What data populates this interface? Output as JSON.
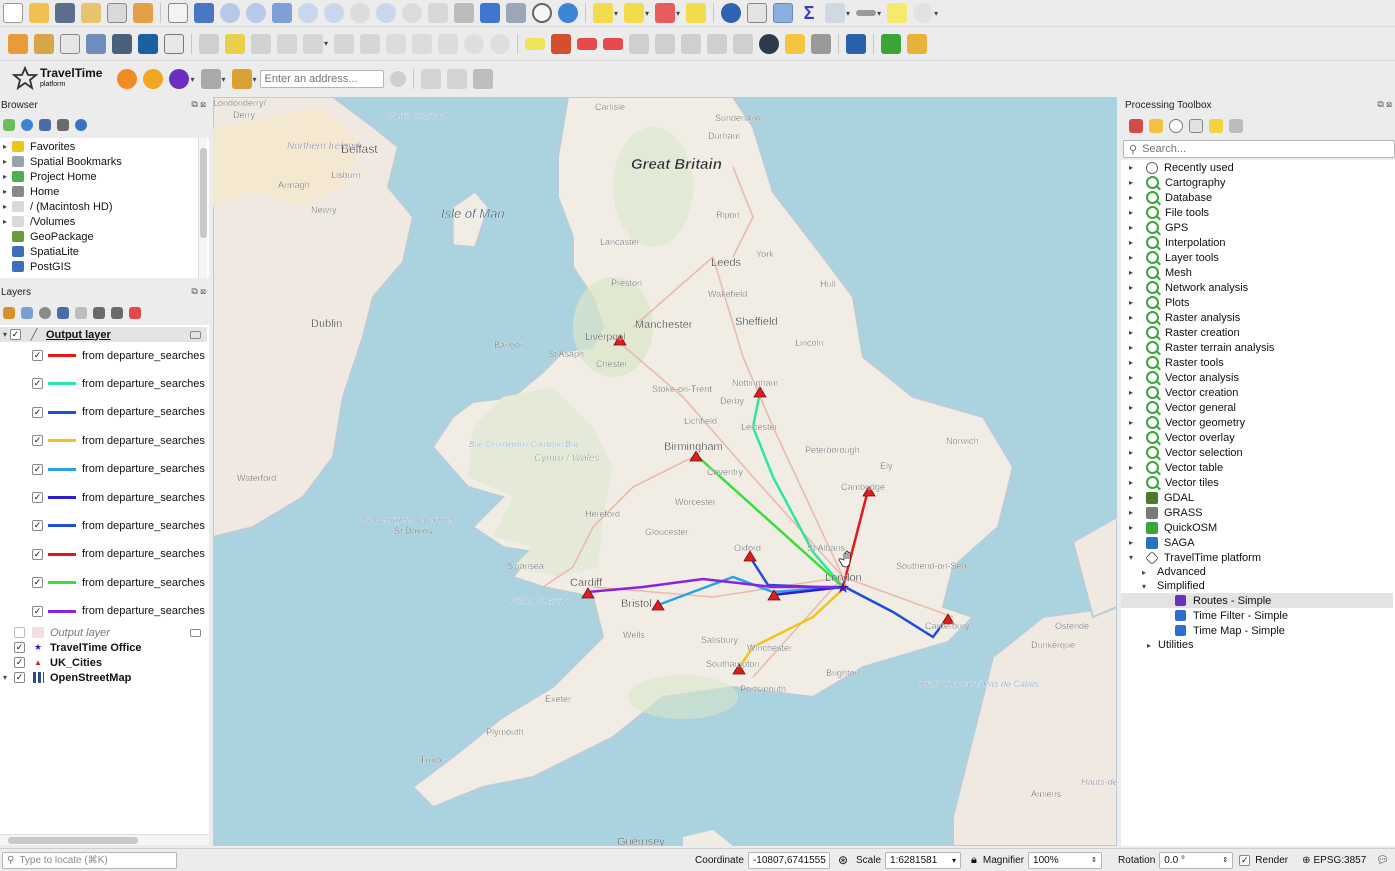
{
  "address": {
    "placeholder": "Enter an address..."
  },
  "plugin": {
    "name": "TravelTime",
    "sub": "platform"
  },
  "browser": {
    "title": "Browser",
    "items": [
      {
        "label": "Favorites"
      },
      {
        "label": "Spatial Bookmarks"
      },
      {
        "label": "Project Home"
      },
      {
        "label": "Home"
      },
      {
        "label": "/ (Macintosh HD)"
      },
      {
        "label": "/Volumes"
      },
      {
        "label": "GeoPackage"
      },
      {
        "label": "SpatiaLite"
      },
      {
        "label": "PostGIS"
      }
    ]
  },
  "layers": {
    "title": "Layers",
    "group1": "Output layer",
    "routes": [
      {
        "label": "from departure_searches",
        "color": "#e8151b"
      },
      {
        "label": "from departure_searches",
        "color": "#2fe6a0"
      },
      {
        "label": "from departure_searches",
        "color": "#1a4fd6"
      },
      {
        "label": "from departure_searches",
        "color": "#f5c21b"
      },
      {
        "label": "from departure_searches",
        "color": "#27a3e8"
      },
      {
        "label": "from departure_searches",
        "color": "#2c1fcf"
      },
      {
        "label": "from departure_searches",
        "color": "#1d4fd8"
      },
      {
        "label": "from departure_searches",
        "color": "#e4161b"
      },
      {
        "label": "from departure_searches",
        "color": "#37e037"
      },
      {
        "label": "from departure_searches",
        "color": "#8a22e0"
      }
    ],
    "group2": "Output layer",
    "office": "TravelTime Office",
    "cities": "UK_Cities",
    "osm": "OpenStreetMap"
  },
  "toolbox": {
    "title": "Processing Toolbox",
    "search_placeholder": "Search...",
    "recent": "Recently used",
    "groups": [
      {
        "label": "Cartography"
      },
      {
        "label": "Database"
      },
      {
        "label": "File tools"
      },
      {
        "label": "GPS"
      },
      {
        "label": "Interpolation"
      },
      {
        "label": "Layer tools"
      },
      {
        "label": "Mesh"
      },
      {
        "label": "Network analysis"
      },
      {
        "label": "Plots"
      },
      {
        "label": "Raster analysis"
      },
      {
        "label": "Raster creation"
      },
      {
        "label": "Raster terrain analysis"
      },
      {
        "label": "Raster tools"
      },
      {
        "label": "Vector analysis"
      },
      {
        "label": "Vector creation"
      },
      {
        "label": "Vector general"
      },
      {
        "label": "Vector geometry"
      },
      {
        "label": "Vector overlay"
      },
      {
        "label": "Vector selection"
      },
      {
        "label": "Vector table"
      },
      {
        "label": "Vector tiles"
      }
    ],
    "providers": [
      {
        "label": "GDAL"
      },
      {
        "label": "GRASS"
      },
      {
        "label": "QuickOSM"
      },
      {
        "label": "SAGA"
      }
    ],
    "tt": "TravelTime platform",
    "advanced": "Advanced",
    "simplified": "Simplified",
    "tools": [
      {
        "label": "Routes - Simple"
      },
      {
        "label": "Time Filter - Simple"
      },
      {
        "label": "Time Map - Simple"
      }
    ],
    "utilities": "Utilities"
  },
  "status": {
    "locate_placeholder": "Type to locate (⌘K)",
    "coord_label": "Coordinate",
    "coord": "-10807,6741555",
    "scale_label": "Scale",
    "scale": "1:6281581",
    "mag_label": "Magnifier",
    "mag": "100%",
    "rot_label": "Rotation",
    "rot": "0.0 °",
    "render": "Render",
    "crs": "EPSG:3857"
  },
  "map": {
    "places": [
      {
        "name": "Great Britain"
      },
      {
        "name": "Isle of Man"
      },
      {
        "name": "Belfast"
      },
      {
        "name": "Dublin"
      },
      {
        "name": "Liverpool"
      },
      {
        "name": "Manchester"
      },
      {
        "name": "Sheffield"
      },
      {
        "name": "Leeds"
      },
      {
        "name": "York"
      },
      {
        "name": "Hull"
      },
      {
        "name": "Lincoln"
      },
      {
        "name": "Nottingham"
      },
      {
        "name": "Derby"
      },
      {
        "name": "Leicester"
      },
      {
        "name": "Birmingham"
      },
      {
        "name": "Coventry"
      },
      {
        "name": "Peterborough"
      },
      {
        "name": "Norwich"
      },
      {
        "name": "Cambridge"
      },
      {
        "name": "Ely"
      },
      {
        "name": "Oxford"
      },
      {
        "name": "St Albans"
      },
      {
        "name": "London"
      },
      {
        "name": "Southend-on-Sea"
      },
      {
        "name": "Canterbury"
      },
      {
        "name": "Cardiff"
      },
      {
        "name": "Bristol"
      },
      {
        "name": "Swansea"
      },
      {
        "name": "Southampton"
      },
      {
        "name": "Portsmouth"
      },
      {
        "name": "Brighton"
      },
      {
        "name": "Winchester"
      },
      {
        "name": "Salisbury"
      },
      {
        "name": "Exeter"
      },
      {
        "name": "Plymouth"
      },
      {
        "name": "Truro"
      },
      {
        "name": "Gloucester"
      },
      {
        "name": "Worcester"
      },
      {
        "name": "Hereford"
      },
      {
        "name": "Lichfield"
      },
      {
        "name": "Stoke-on-Trent"
      },
      {
        "name": "Chester"
      },
      {
        "name": "Bangor"
      },
      {
        "name": "St Asaph"
      },
      {
        "name": "St Davids"
      },
      {
        "name": "Wells"
      },
      {
        "name": "Carlisle"
      },
      {
        "name": "Sunderland"
      },
      {
        "name": "Durham"
      },
      {
        "name": "Ripon"
      },
      {
        "name": "Lancaster"
      },
      {
        "name": "Preston"
      },
      {
        "name": "Wakefield"
      },
      {
        "name": "Armagh"
      },
      {
        "name": "Newry"
      },
      {
        "name": "Lisburn"
      },
      {
        "name": "Waterford"
      },
      {
        "name": "Ostende"
      },
      {
        "name": "Dunkerque"
      },
      {
        "name": "Amiens"
      },
      {
        "name": "Guernsey"
      },
      {
        "name": "Derry"
      },
      {
        "name": "Northern Ireland"
      },
      {
        "name": "North Channel"
      },
      {
        "name": "St George's Channel"
      },
      {
        "name": "Bristol Channel"
      },
      {
        "name": "Cymru / Wales"
      },
      {
        "name": "Strait of Dover / Pas de Calais"
      },
      {
        "name": "Hauts-de-France"
      },
      {
        "name": "Londonderry/"
      },
      {
        "name": "Bae Ceredigion / Cardigan Bay"
      }
    ]
  }
}
